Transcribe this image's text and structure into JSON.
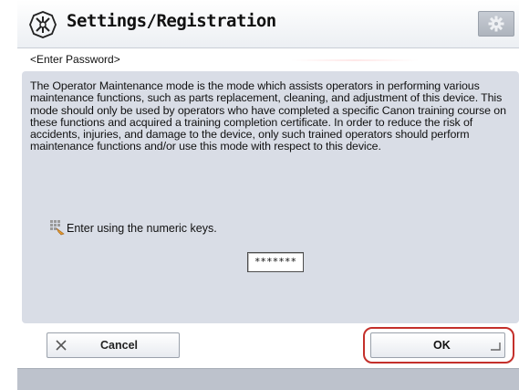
{
  "header": {
    "title": "Settings/Registration",
    "title_icon": "settings-registration-icon",
    "settings_icon": "gear-icon"
  },
  "subheader": {
    "label": "<Enter Password>"
  },
  "notice": {
    "text": "The Operator Maintenance mode is the mode which assists operators in performing various maintenance functions, such as parts replacement, cleaning, and adjustment of this device. This mode should only be used by operators who have completed a specific Canon training course on these functions and acquired a training completion certificate. In order to reduce the risk of accidents, injuries, and damage to the device, only such trained operators should perform maintenance functions and/or use this mode with respect to this device."
  },
  "input": {
    "instruction": "Enter using the numeric keys.",
    "instruction_icon": "numeric-keys-icon",
    "password_value": "*******"
  },
  "buttons": {
    "cancel_label": "Cancel",
    "cancel_icon": "close-icon",
    "ok_label": "OK"
  },
  "colors": {
    "panel": "#d9dde6",
    "highlight": "#c4302b",
    "statusbar": "#bdc2cc"
  }
}
